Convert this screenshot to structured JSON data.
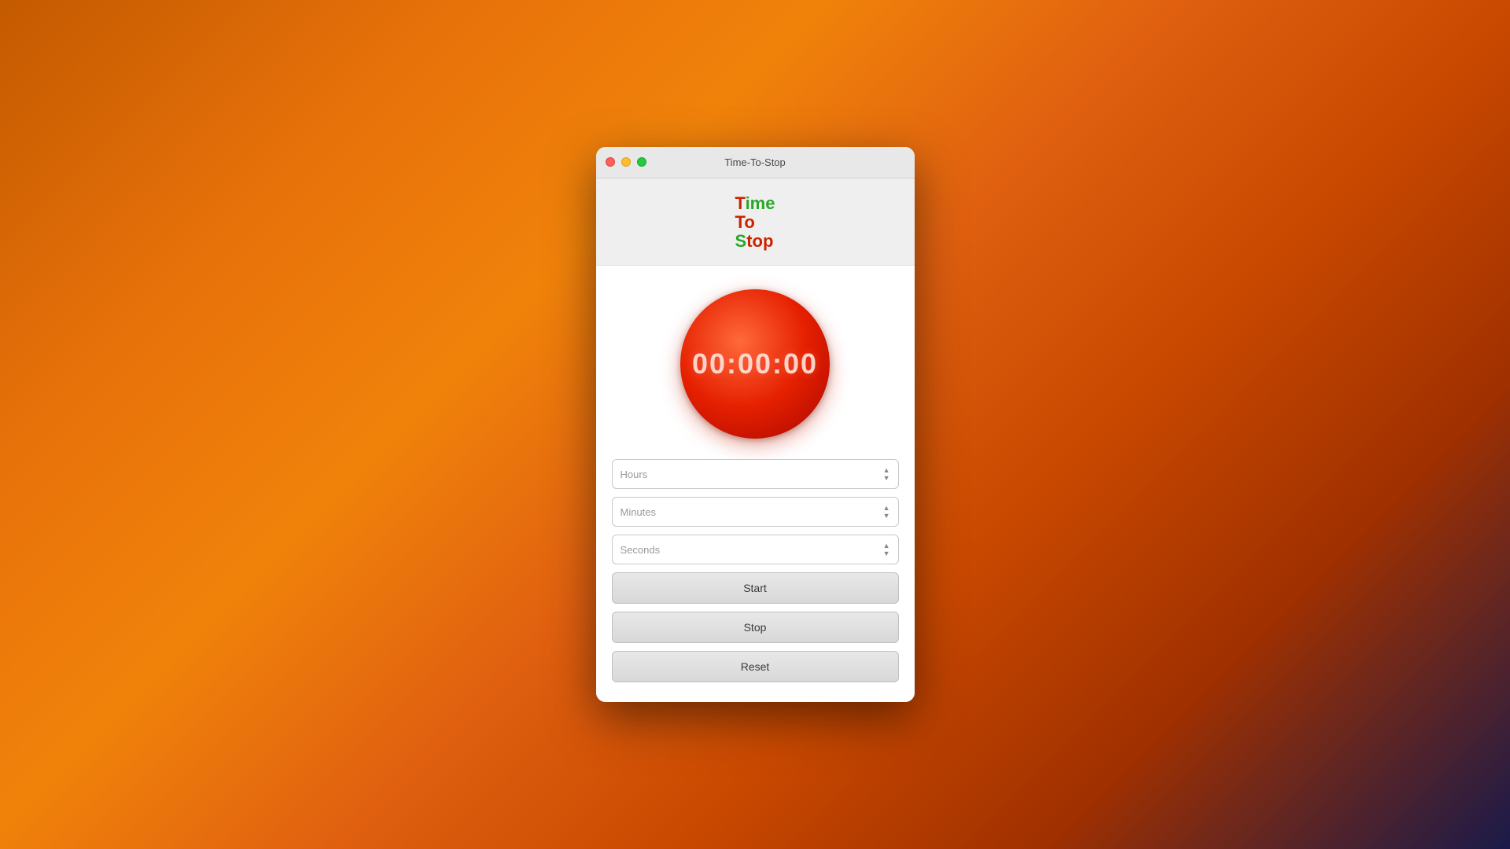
{
  "window": {
    "title": "Time-To-Stop"
  },
  "trafficLights": {
    "close": "close",
    "minimize": "minimize",
    "maximize": "maximize"
  },
  "logo": {
    "line1_T": "T",
    "line1_ime": "ime",
    "line2": "To",
    "line3_S": "S",
    "line3_top": "top"
  },
  "timer": {
    "display": "00:00:00"
  },
  "inputs": {
    "hours_placeholder": "Hours",
    "minutes_placeholder": "Minutes",
    "seconds_placeholder": "Seconds"
  },
  "buttons": {
    "start": "Start",
    "stop": "Stop",
    "reset": "Reset"
  }
}
